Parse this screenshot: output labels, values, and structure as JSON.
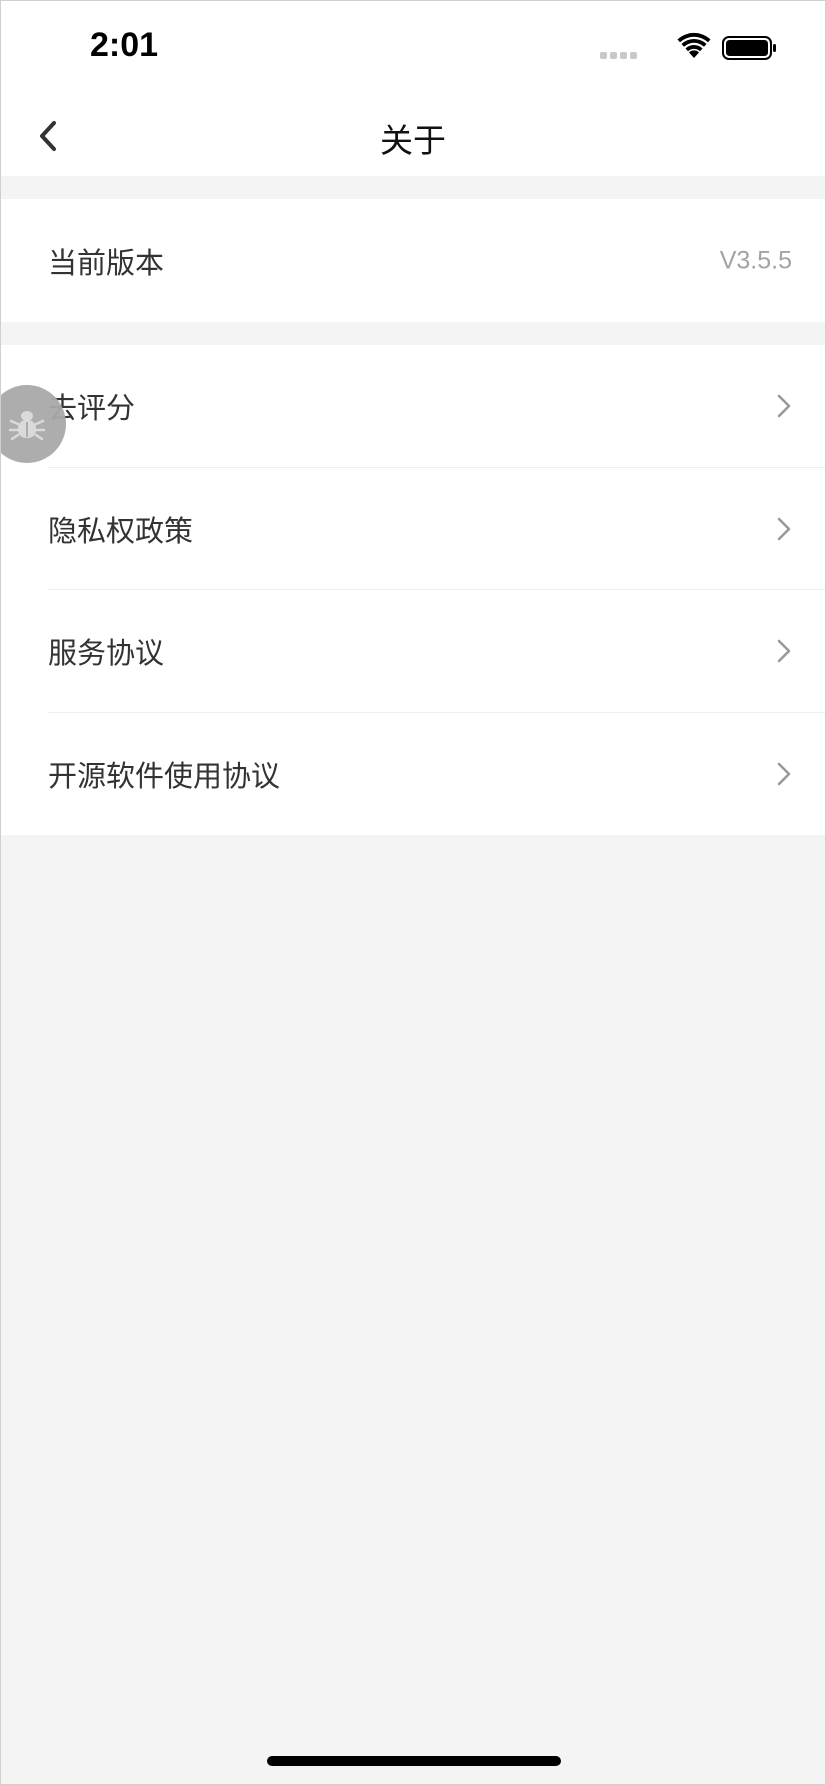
{
  "status_bar": {
    "time": "2:01",
    "icons": [
      "signal-icon",
      "wifi-icon",
      "battery-icon"
    ]
  },
  "nav": {
    "title": "关于",
    "back_icon": "chevron-left-icon"
  },
  "version_row": {
    "label": "当前版本",
    "value": "V3.5.5"
  },
  "menu": {
    "items": [
      {
        "label": "去评分",
        "icon": "chevron-right-icon"
      },
      {
        "label": "隐私权政策",
        "icon": "chevron-right-icon"
      },
      {
        "label": "服务协议",
        "icon": "chevron-right-icon"
      },
      {
        "label": "开源软件使用协议",
        "icon": "chevron-right-icon"
      }
    ]
  },
  "debug_button": {
    "icon": "bug-icon"
  },
  "colors": {
    "background": "#f4f4f4",
    "surface": "#ffffff",
    "text_primary": "#333333",
    "text_secondary": "#a3a3a3",
    "chevron": "#999999"
  }
}
